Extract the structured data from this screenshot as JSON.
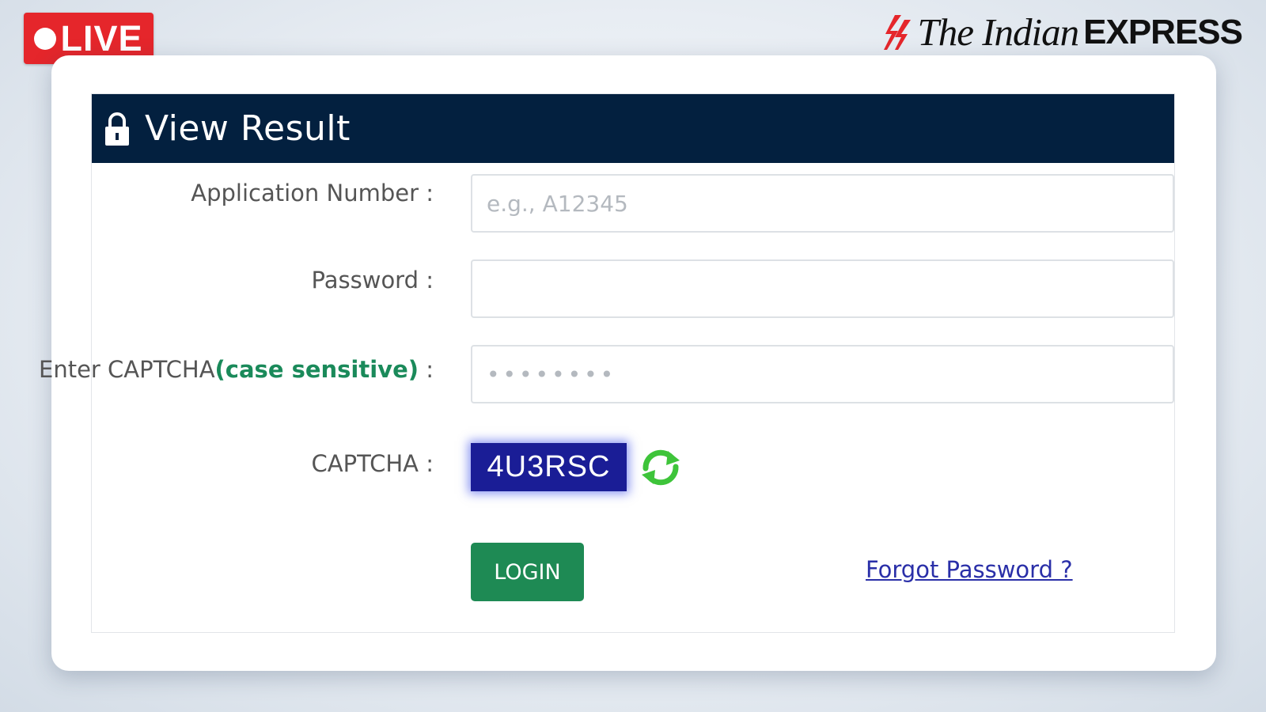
{
  "live_badge": {
    "text": "LIVE",
    "color": "#e5262b"
  },
  "brand": {
    "name": "The Indian",
    "suffix": "EXPRESS",
    "icon": "brand-logo-mark"
  },
  "panel": {
    "title": "View Result",
    "header_icon": "lock-icon",
    "header_color": "#03203f"
  },
  "form": {
    "application_number": {
      "label": "Application Number :",
      "placeholder": "e.g., A12345",
      "value": ""
    },
    "password": {
      "label": "Password :",
      "value": ""
    },
    "captcha_input": {
      "label_main": "Enter CAPTCHA",
      "label_hint": "(case sensitive)",
      "label_suffix": " :",
      "placeholder": "••••••••",
      "value": ""
    },
    "captcha": {
      "label": "CAPTCHA :",
      "code": "4U3RSC",
      "refresh_icon": "refresh-icon"
    },
    "login_label": "LOGIN",
    "forgot_password": "Forgot Password ?"
  },
  "colors": {
    "accent_green": "#1e8a54",
    "hint_green": "#1a8a5a",
    "link_blue": "#2a2fa8",
    "captcha_bg": "#1a1d96"
  }
}
